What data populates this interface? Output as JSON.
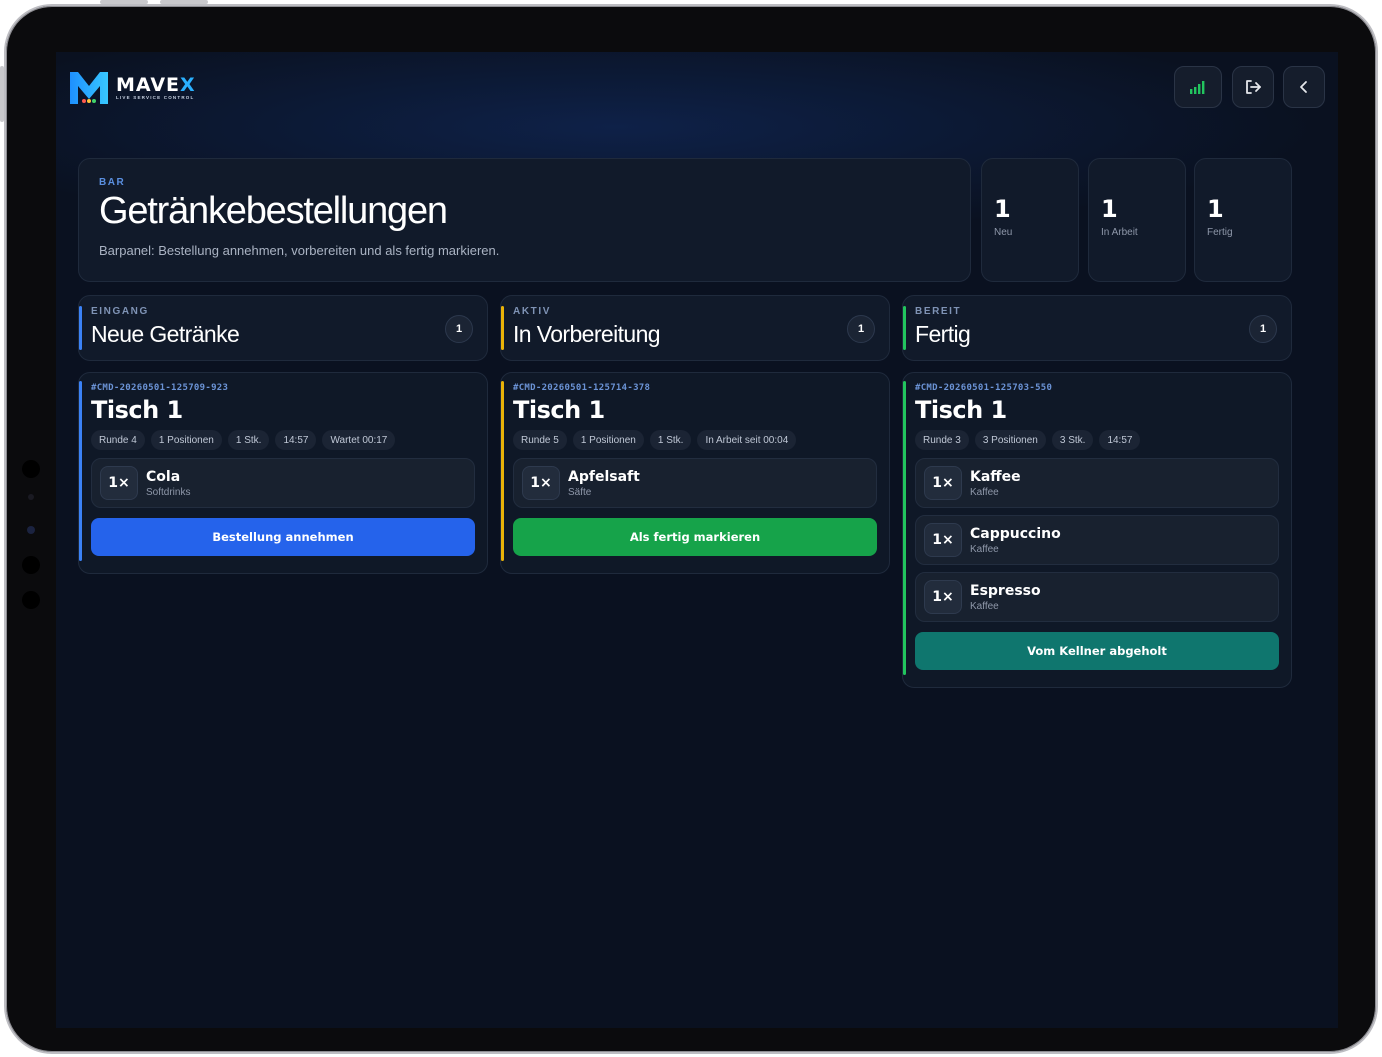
{
  "brand": {
    "name": "MAVE",
    "name_accent": "X",
    "tagline": "LIVE SERVICE CONTROL"
  },
  "header": {
    "icons": [
      "signal-icon",
      "logout-icon",
      "chevron-left-icon"
    ]
  },
  "hero": {
    "eyebrow": "BAR",
    "title": "Getränkebestellungen",
    "subtitle": "Barpanel: Bestellung annehmen, vorbereiten und als fertig markieren."
  },
  "stats": [
    {
      "value": "1",
      "label": "Neu"
    },
    {
      "value": "1",
      "label": "In Arbeit"
    },
    {
      "value": "1",
      "label": "Fertig"
    }
  ],
  "columns": [
    {
      "eyebrow": "EINGANG",
      "title": "Neue Getränke",
      "count": "1",
      "accent": "#3b82f6",
      "order": {
        "id": "#CMD-20260501-125709-923",
        "table": "Tisch 1",
        "chips": [
          "Runde 4",
          "1 Positionen",
          "1 Stk.",
          "14:57",
          "Wartet 00:17"
        ],
        "items": [
          {
            "qty": "1×",
            "name": "Cola",
            "category": "Softdrinks"
          }
        ],
        "action_label": "Bestellung annehmen",
        "action_color": "#2563eb"
      }
    },
    {
      "eyebrow": "AKTIV",
      "title": "In Vorbereitung",
      "count": "1",
      "accent": "#eab308",
      "order": {
        "id": "#CMD-20260501-125714-378",
        "table": "Tisch 1",
        "chips": [
          "Runde 5",
          "1 Positionen",
          "1 Stk.",
          "In Arbeit seit 00:04"
        ],
        "items": [
          {
            "qty": "1×",
            "name": "Apfelsaft",
            "category": "Säfte"
          }
        ],
        "action_label": "Als fertig markieren",
        "action_color": "#16a34a"
      }
    },
    {
      "eyebrow": "BEREIT",
      "title": "Fertig",
      "count": "1",
      "accent": "#22c55e",
      "order": {
        "id": "#CMD-20260501-125703-550",
        "table": "Tisch 1",
        "chips": [
          "Runde 3",
          "3 Positionen",
          "3 Stk.",
          "14:57"
        ],
        "items": [
          {
            "qty": "1×",
            "name": "Kaffee",
            "category": "Kaffee"
          },
          {
            "qty": "1×",
            "name": "Cappuccino",
            "category": "Kaffee"
          },
          {
            "qty": "1×",
            "name": "Espresso",
            "category": "Kaffee"
          }
        ],
        "action_label": "Vom Kellner abgeholt",
        "action_color": "#0f766e"
      }
    }
  ]
}
